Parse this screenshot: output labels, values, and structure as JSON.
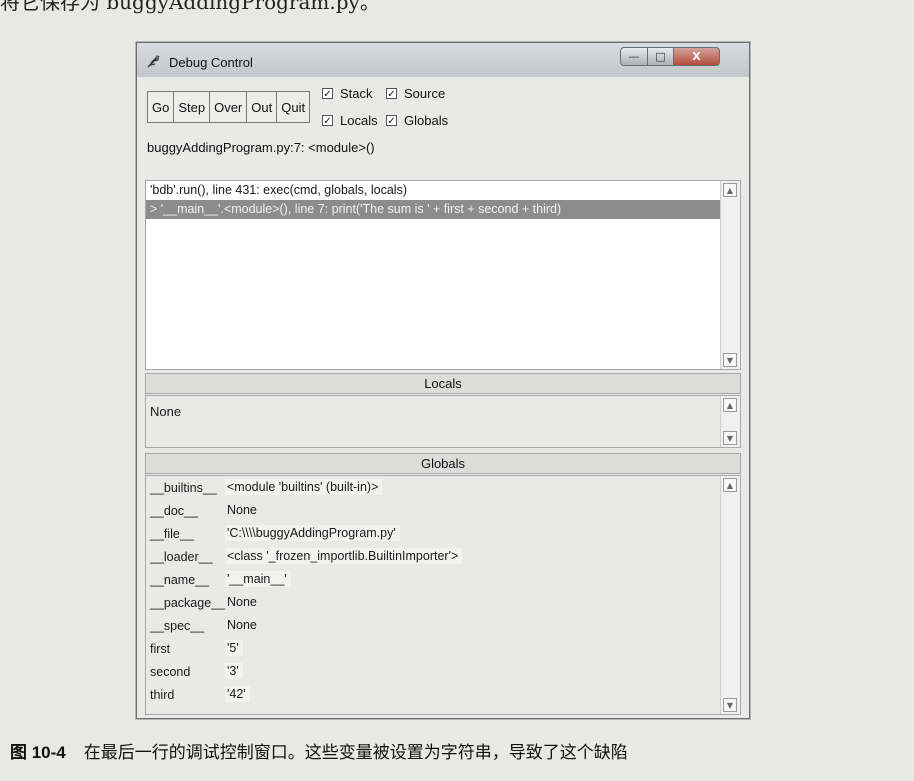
{
  "page": {
    "header_text": "将它保存为 buggyAddingProgram.py。",
    "caption_figure": "图 10-4",
    "caption_text": "在最后一行的调试控制窗口。这些变量被设置为字符串，导致了这个缺陷"
  },
  "window": {
    "title": "Debug Control",
    "controls": {
      "minimize": "—",
      "maximize": "□",
      "close": "X"
    }
  },
  "toolbar": {
    "buttons": [
      "Go",
      "Step",
      "Over",
      "Out",
      "Quit"
    ],
    "checkboxes": [
      {
        "label": "Stack",
        "checked": true
      },
      {
        "label": "Source",
        "checked": true
      },
      {
        "label": "Locals",
        "checked": true
      },
      {
        "label": "Globals",
        "checked": true
      }
    ],
    "check_mark": "✓"
  },
  "status_line": "buggyAddingProgram.py:7: <module>()",
  "stack": {
    "rows": [
      "'bdb'.run(), line 431: exec(cmd, globals, locals)",
      "> '__main__'.<module>(), line 7: print('The sum is ' + first + second + third)"
    ],
    "selected_index": 1
  },
  "locals": {
    "heading": "Locals",
    "value": "None"
  },
  "globals": {
    "heading": "Globals",
    "rows": [
      {
        "name": "__builtins__",
        "value": "<module 'builtins' (built-in)>"
      },
      {
        "name": "__doc__",
        "value": "None"
      },
      {
        "name": "__file__",
        "value": "'C:\\\\\\\\buggyAddingProgram.py'"
      },
      {
        "name": "__loader__",
        "value": "<class '_frozen_importlib.BuiltinImporter'>"
      },
      {
        "name": "__name__",
        "value": "'__main__'"
      },
      {
        "name": "__package__",
        "value": "None"
      },
      {
        "name": "__spec__",
        "value": "None"
      },
      {
        "name": "first",
        "value": "'5'"
      },
      {
        "name": "second",
        "value": "'3'"
      },
      {
        "name": "third",
        "value": "'42'"
      }
    ]
  },
  "scroll_icons": {
    "up": "▲",
    "down": "▼"
  },
  "colors": {
    "selected_row": "#8c8c8c",
    "close_button": "#b44e3d"
  }
}
